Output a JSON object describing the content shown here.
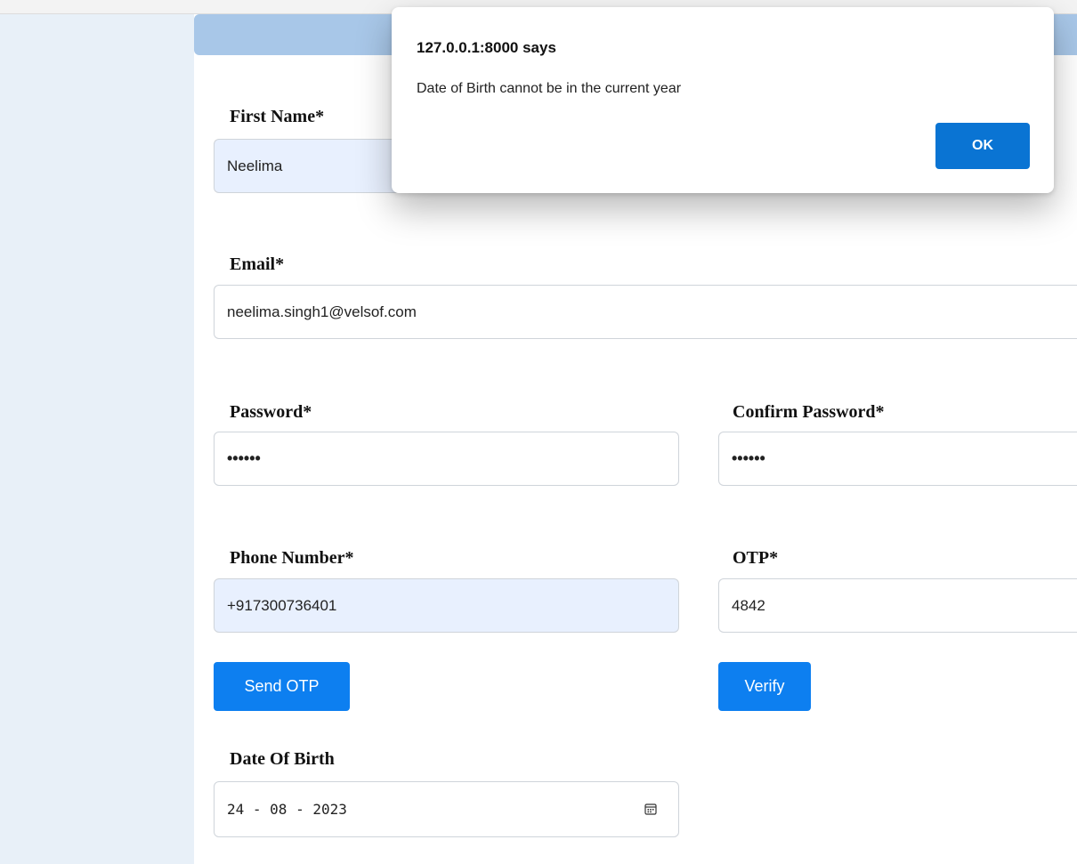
{
  "form": {
    "first_name": {
      "label": "First Name*",
      "value": "Neelima"
    },
    "email": {
      "label": "Email*",
      "value": "neelima.singh1@velsof.com"
    },
    "password": {
      "label": "Password*",
      "value": "••••••"
    },
    "confirm_password": {
      "label": "Confirm Password*",
      "value": "••••••"
    },
    "phone": {
      "label": "Phone Number*",
      "value": "+917300736401"
    },
    "otp": {
      "label": "OTP*",
      "value": "4842"
    },
    "send_otp_label": "Send OTP",
    "verify_label": "Verify",
    "dob": {
      "label": "Date Of Birth",
      "value": "24 - 08 - 2023"
    },
    "icons": {
      "dob_picker": "calendar-icon"
    }
  },
  "dialog": {
    "title": "127.0.0.1:8000 says",
    "message": "Date of Birth cannot be in the current year",
    "ok_label": "OK"
  },
  "colors": {
    "primary_button": "#0d7ff0",
    "dialog_ok": "#0a74d3",
    "header_band": "#a8c7e8",
    "left_panel": "#e8f0f8",
    "autofill": "#e8f0fe"
  }
}
